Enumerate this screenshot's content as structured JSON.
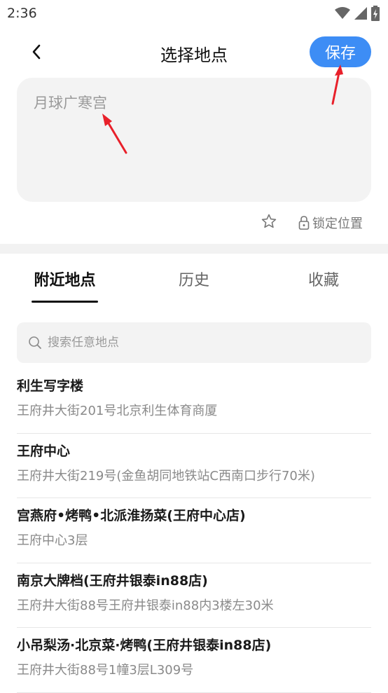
{
  "status_bar": {
    "time": "2:36",
    "icons": [
      "wifi-icon",
      "cellular-signal-icon",
      "battery-charging-icon"
    ]
  },
  "header": {
    "back_icon": "chevron-left-icon",
    "title": "选择地点",
    "save_label": "保存"
  },
  "location_input": {
    "placeholder": "月球广寒宫",
    "value": ""
  },
  "location_actions": {
    "star_icon": "star-outline-icon",
    "lock_icon": "lock-icon",
    "lock_label": "锁定位置"
  },
  "tabs": [
    {
      "label": "附近地点",
      "active": true
    },
    {
      "label": "历史",
      "active": false
    },
    {
      "label": "收藏",
      "active": false
    }
  ],
  "search": {
    "icon": "search-icon",
    "placeholder": "搜索任意地点"
  },
  "places": [
    {
      "name": "利生写字楼",
      "address": "王府井大街201号北京利生体育商厦"
    },
    {
      "name": "王府中心",
      "address": "王府井大街219号(金鱼胡同地铁站C西南口步行70米)"
    },
    {
      "name": "宫燕府•烤鸭•北派淮扬菜(王府中心店)",
      "address": "王府中心3层"
    },
    {
      "name": "南京大牌档(王府井银泰in88店)",
      "address": "王府井大街88号王府井银泰in88内3楼左30米"
    },
    {
      "name": "小吊梨汤·北京菜·烤鸭(王府井银泰in88店)",
      "address": "王府井大街88号1幢3层L309号"
    }
  ],
  "colors": {
    "accent": "#3d8df5",
    "annotation_arrow": "#e8202a",
    "input_background": "#f3f3f3",
    "secondary_text": "#8a8a8a"
  }
}
